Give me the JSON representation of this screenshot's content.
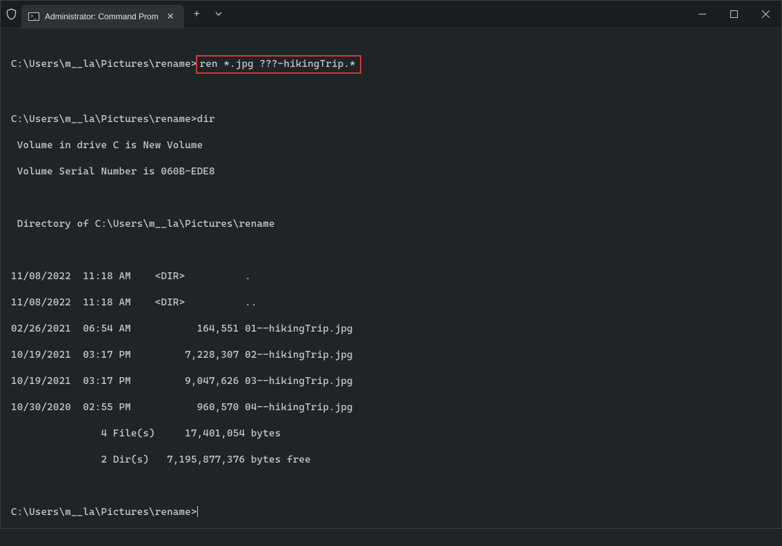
{
  "window": {
    "tab_title": "Administrator: Command Prom"
  },
  "terminal": {
    "prompt_path": "C:\\Users\\m__la\\Pictures\\rename>",
    "cmd1_highlighted": "ren *.jpg ???-hikingTrip.*",
    "cmd2": "dir",
    "vol_line1": " Volume in drive C is New Volume",
    "vol_line2": " Volume Serial Number is 060B-EDE8",
    "dir_of": " Directory of C:\\Users\\m__la\\Pictures\\rename",
    "rows": [
      "11/08/2022  11:18 AM    <DIR>          .",
      "11/08/2022  11:18 AM    <DIR>          ..",
      "02/26/2021  06:54 AM           164,551 01--hikingTrip.jpg",
      "10/19/2021  03:17 PM         7,228,307 02--hikingTrip.jpg",
      "10/19/2021  03:17 PM         9,047,626 03--hikingTrip.jpg",
      "10/30/2020  02:55 PM           960,570 04--hikingTrip.jpg"
    ],
    "summary1": "               4 File(s)     17,401,054 bytes",
    "summary2": "               2 Dir(s)   7,195,877,376 bytes free"
  }
}
